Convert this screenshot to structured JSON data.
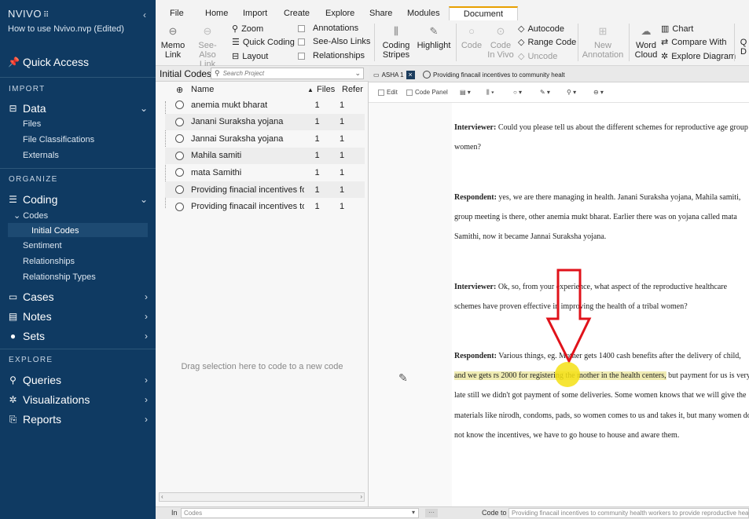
{
  "app": {
    "brand": "NVIVO",
    "brand_mark": "⠿",
    "project_name": "How to use Nvivo.nvp (Edited)",
    "collapse_glyph": "‹"
  },
  "sidebar": {
    "quick_access": "Quick Access",
    "sections": {
      "import": "IMPORT",
      "organize": "ORGANIZE",
      "explore": "EXPLORE"
    },
    "data": {
      "label": "Data",
      "items": [
        "Files",
        "File Classifications",
        "Externals"
      ]
    },
    "coding": {
      "label": "Coding",
      "codes_label": "Codes",
      "initial_codes": "Initial Codes",
      "items": [
        "Sentiment",
        "Relationships",
        "Relationship Types"
      ]
    },
    "cases": "Cases",
    "notes": "Notes",
    "sets": "Sets",
    "explore": {
      "queries": "Queries",
      "visualizations": "Visualizations",
      "reports": "Reports"
    }
  },
  "ribbon": {
    "menus": [
      "File",
      "Home",
      "Import",
      "Create",
      "Explore",
      "Share",
      "Modules"
    ],
    "active_menu": "Document",
    "memo_link": [
      "Memo",
      "Link"
    ],
    "see_also_link": [
      "See-Also",
      "Link"
    ],
    "zoom": "Zoom",
    "quick_coding": "Quick Coding",
    "layout": "Layout",
    "annotations": "Annotations",
    "see_also_links": "See-Also Links",
    "relationships": "Relationships",
    "coding_stripes": [
      "Coding",
      "Stripes"
    ],
    "highlight": "Highlight",
    "code": "Code",
    "code_in_vivo": [
      "Code",
      "In Vivo"
    ],
    "autocode": "Autocode",
    "range_code": "Range Code",
    "uncode": "Uncode",
    "new_annotation": [
      "New",
      "Annotation"
    ],
    "word_cloud": [
      "Word",
      "Cloud"
    ],
    "chart": "Chart",
    "compare_with": "Compare With",
    "explore_diagram": "Explore Diagram",
    "overflow": [
      "Q",
      "D"
    ]
  },
  "codes_panel": {
    "title": "Initial Codes",
    "search_placeholder": "Search Project",
    "columns": {
      "name": "Name",
      "files": "Files",
      "refs": "Refer"
    },
    "rows": [
      {
        "name": "anemia mukt bharat",
        "files": "1",
        "refs": "1"
      },
      {
        "name": "Janani Suraksha yojana",
        "files": "1",
        "refs": "1"
      },
      {
        "name": "Jannai Suraksha yojana",
        "files": "1",
        "refs": "1"
      },
      {
        "name": "Mahila samiti",
        "files": "1",
        "refs": "1"
      },
      {
        "name": "mata Samithi",
        "files": "1",
        "refs": "1"
      },
      {
        "name": "Providing  finacial incentives fo",
        "files": "1",
        "refs": "1"
      },
      {
        "name": "Providing finacail incentives to",
        "files": "1",
        "refs": "1"
      }
    ],
    "drag_hint": "Drag selection here to code to a new code"
  },
  "document": {
    "tabs": [
      {
        "label": "ASHA 1"
      },
      {
        "label": "Providing finacail incentives to community healt"
      }
    ],
    "toolbar": {
      "edit": "Edit",
      "code_panel": "Code Panel"
    },
    "paragraphs": [
      {
        "speaker": "Interviewer:",
        "text": " Could you please tell us about the different schemes for reproductive age group women?"
      },
      {
        "speaker": "Respondent:",
        "text": " yes, we are there managing in health. Janani Suraksha yojana, Mahila samiti, group meeting is there, other anemia mukt bharat. Earlier there was on yojana called mata Samithi, now it became Jannai Suraksha yojana."
      },
      {
        "speaker": "Interviewer:",
        "text": " Ok, so, from your experience, what aspect of the reproductive healthcare schemes have proven effective in improving the health of a tribal women?"
      },
      {
        "speaker": "Respondent:",
        "pre": " Various things, eg. Mother gets 1400 cash benefits after the delivery of child, ",
        "highlight": "and we gets rs 2000 for registering the mother in the health centers,",
        "post": " but payment for us is very late still we didn't got payment of some deliveries. Some women knows that we will give the materials like nirodh, condoms, pads, so women comes to us and takes it, but many women do not know the incentives, we have to go house to house and aware them."
      }
    ]
  },
  "status": {
    "in_label": "In",
    "in_value": "Codes",
    "code_to_label": "Code to",
    "code_to_value": "Providing finacail incentives to community health workers to provide reproductive health"
  },
  "colors": {
    "sidebar": "#0f3a62",
    "accent": "#e8a000",
    "highlight": "#f0ecb3",
    "arrow": "#e0121a"
  }
}
